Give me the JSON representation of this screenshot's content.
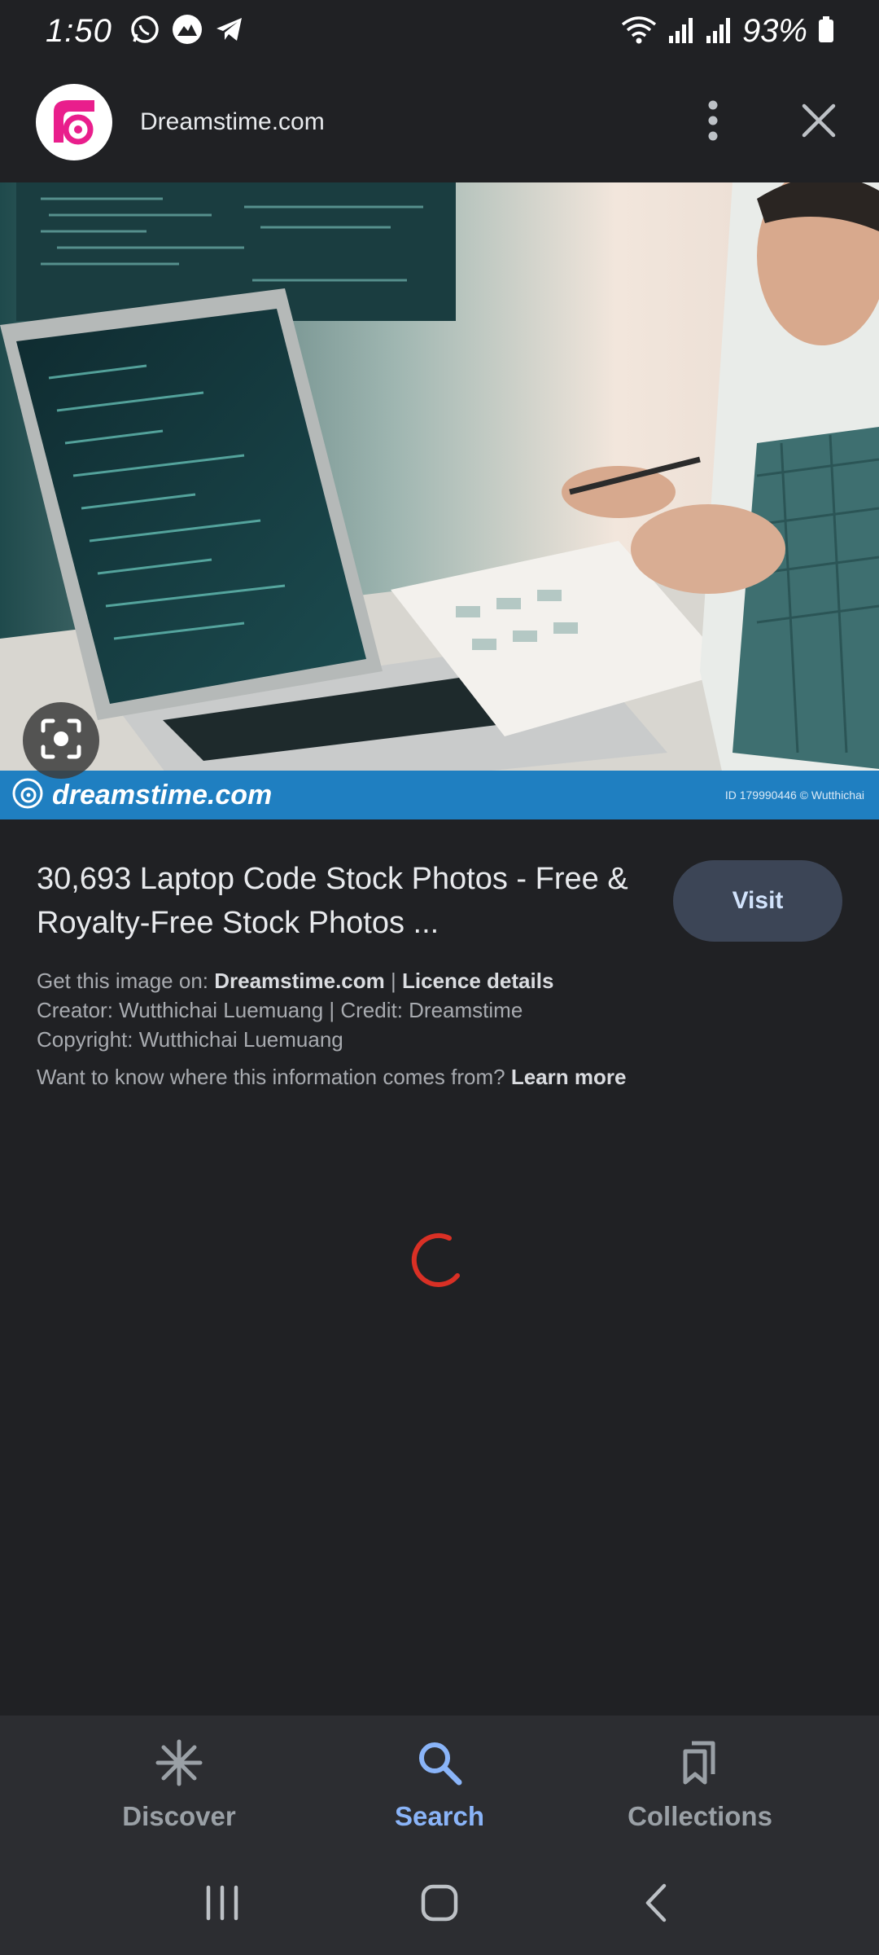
{
  "status_bar": {
    "time": "1:50",
    "battery": "93%",
    "left_icons": [
      "whatsapp-icon",
      "app-icon",
      "telegram-icon"
    ],
    "right_icons": [
      "wifi-icon",
      "signal-icon",
      "signal-icon",
      "battery-icon"
    ]
  },
  "header": {
    "site_name": "Dreamstime.com",
    "logo_icon": "dreamstime-logo",
    "more_icon": "more-vert-icon",
    "close_icon": "close-icon"
  },
  "image": {
    "watermark": "dreamstime.com",
    "watermark_id": "ID 179990446 © Wutthichai"
  },
  "result": {
    "title": "30,693 Laptop Code Stock Photos - Free & Royalty-Free Stock Photos ...",
    "visit_label": "Visit",
    "get_image_prefix": "Get this image on: ",
    "get_image_source": "Dreamstime.com",
    "separator": " | ",
    "licence_label": "Licence details",
    "creator_line": "Creator: Wutthichai Luemuang | Credit: Dreamstime",
    "copyright_line": "Copyright: Wutthichai Luemuang",
    "info_question": "Want to know where this information comes from? ",
    "learn_more": "Learn more"
  },
  "bottom_nav": {
    "items": [
      {
        "label": "Discover",
        "icon": "asterisk-icon",
        "active": false
      },
      {
        "label": "Search",
        "icon": "search-icon",
        "active": true
      },
      {
        "label": "Collections",
        "icon": "bookmarks-icon",
        "active": false
      }
    ]
  },
  "colors": {
    "background": "#202124",
    "accent": "#8ab4f8",
    "spinner": "#d93025",
    "watermark_bar": "#1f7fc1"
  }
}
